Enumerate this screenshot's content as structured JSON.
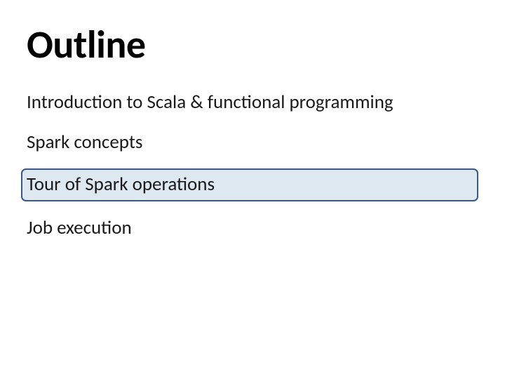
{
  "slide": {
    "title": "Outline",
    "bullets": [
      {
        "text": "Introduction to Scala & functional programming",
        "highlighted": false
      },
      {
        "text": "Spark concepts",
        "highlighted": false
      },
      {
        "text": "Tour of Spark operations",
        "highlighted": true
      },
      {
        "text": "Job execution",
        "highlighted": false
      }
    ]
  },
  "colors": {
    "highlight_bg": "#dde8f1",
    "highlight_border": "#3a5787"
  }
}
